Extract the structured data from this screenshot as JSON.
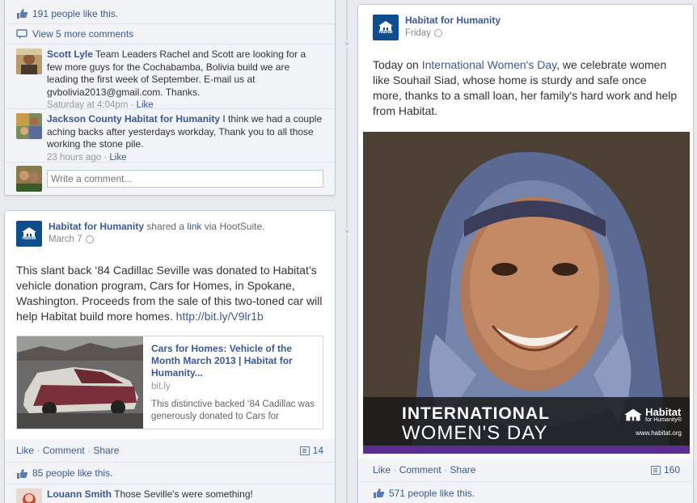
{
  "left_top_post": {
    "likes_text": "191 people like this.",
    "view_more": "View 5 more comments",
    "comments": [
      {
        "name": "Scott Lyle",
        "text": "Team Leaders Rachel and Scott are looking for a few more guys for the Cochabamba, Bolivia build we are leading the first week of September. E-mail us at gvbolivia2013@gmail.com. Thanks.",
        "time": "Saturday at 4:04pm",
        "like": "Like"
      },
      {
        "name": "Jackson County Habitat for Humanity",
        "text": "I think we had a couple aching backs after yesterdays workday, Thank you to all those working the stone pile.",
        "time": "23 hours ago",
        "like": "Like"
      }
    ],
    "write_comment_placeholder": "Write a comment..."
  },
  "left_post": {
    "page_name": "Habitat for Humanity",
    "shared": "shared a",
    "link_word": "link",
    "via": "via HootSuite.",
    "date": "March 7",
    "body": "This slant back ‘84 Cadillac Seville was donated to Habitat’s vehicle donation program, Cars for Homes, in Spokane, Washington. Proceeds from the sale of this two-toned car will help Habitat build more homes.",
    "body_link": "http://bit.ly/V9lr1b",
    "preview": {
      "title": "Cars for Homes: Vehicle of the Month March 2013 | Habitat for Humanity...",
      "domain": "bit.ly",
      "desc": "This distinctive backed ‘84 Cadillac was generously donated to Cars for"
    },
    "actions": {
      "like": "Like",
      "comment": "Comment",
      "share": "Share",
      "sep": "·"
    },
    "comment_count": "14",
    "likes_text": "85 people like this.",
    "comment": {
      "name": "Louann Smith",
      "text": "Those Seville's were something!"
    }
  },
  "right_post": {
    "page_name": "Habitat for Humanity",
    "date": "Friday",
    "body_pre": "Today on ",
    "body_link": "International Women's Day",
    "body_post": ", we celebrate women like Souhail Siad, whose home is sturdy and safe once more, thanks to a small loan, her family's hard work and help from Habitat.",
    "image_banner": {
      "line1": "INTERNATIONAL",
      "line2": "WOMEN'S DAY",
      "brand": "Habitat",
      "brand_sub": "for Humanity®",
      "url": "www.habitat.org"
    },
    "actions": {
      "like": "Like",
      "comment": "Comment",
      "share": "Share",
      "sep": "·"
    },
    "comment_count": "160",
    "likes_text": "571 people like this."
  },
  "logo_text": {
    "l1": "Habitat",
    "l2": "for Humanity"
  },
  "colors": {
    "link": "#3b5998",
    "ufi_bg": "#f2f3f7",
    "logo_blue": "#0e4e8e",
    "purple": "#6b3fa0"
  }
}
